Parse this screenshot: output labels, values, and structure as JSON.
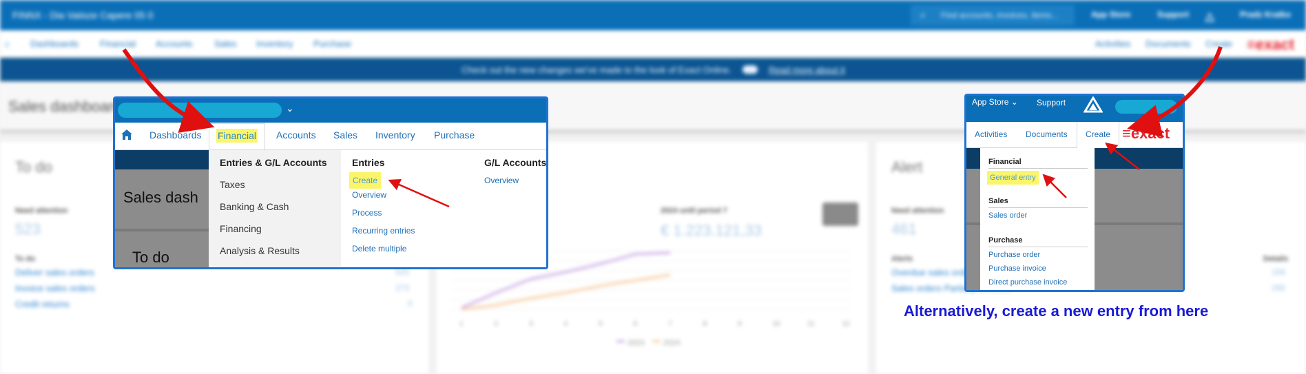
{
  "background": {
    "company": "FINNX - Dia Vaiisze Capere 05 0",
    "search_placeholder": "Find accounts, invoices, items...",
    "top_items": [
      "App Store",
      "Support",
      "Pradz Kratko"
    ],
    "nav_items": [
      "Dashboards",
      "Financial",
      "Accounts",
      "Sales",
      "Inventory",
      "Purchase"
    ],
    "nav_right": [
      "Activities",
      "Documents",
      "Create"
    ],
    "logo": "≡exact",
    "banner_text": "Check out the new changes we've made to the look of Exact Online.",
    "banner_link": "Read more about it",
    "page_title": "Sales dashboard",
    "todo_card": {
      "title": "To do",
      "need_attention": "Need attention",
      "count": "523",
      "section": "To do",
      "links": [
        "Deliver sales orders",
        "Invoice sales orders",
        "Credit returns"
      ],
      "values": [
        "520",
        "273",
        "0"
      ]
    },
    "chart_card": {
      "period_label": "2024 until period 7",
      "amount": "€ 1.223.121,33",
      "x_ticks": [
        "1",
        "2",
        "3",
        "4",
        "5",
        "6",
        "7",
        "8",
        "9",
        "10",
        "11",
        "12"
      ],
      "legend": [
        "2023",
        "2024"
      ]
    },
    "alert_card": {
      "title": "Alert",
      "need_attention": "Need attention",
      "count": "461",
      "col_alerts": "Alerts",
      "col_details": "Details",
      "links": [
        "Overdue sales orders",
        "Sales orders Partially invoiced"
      ],
      "values": [
        "166",
        "295"
      ]
    }
  },
  "popup_left": {
    "nav": [
      "Dashboards",
      "Financial",
      "Accounts",
      "Sales",
      "Inventory",
      "Purchase"
    ],
    "bg_text_1": "Sales dash",
    "bg_text_2": "To do",
    "menu_heading": "Entries & G/L Accounts",
    "menu_side_items": [
      "Taxes",
      "Banking & Cash",
      "Financing",
      "Analysis & Results"
    ],
    "entries_heading": "Entries",
    "entries_links": [
      "Create",
      "Overview",
      "Process",
      "Recurring entries",
      "Delete multiple"
    ],
    "gl_heading": "G/L Accounts",
    "gl_links": [
      "Overview"
    ]
  },
  "popup_right": {
    "top_items": [
      "App Store",
      "Support"
    ],
    "nav": [
      "Activities",
      "Documents",
      "Create"
    ],
    "logo": "≡exact",
    "sections": [
      {
        "title": "Financial",
        "links": [
          "General entry"
        ]
      },
      {
        "title": "Sales",
        "links": [
          "Sales order"
        ]
      },
      {
        "title": "Purchase",
        "links": [
          "Purchase order",
          "Purchase invoice",
          "Direct purchase invoice"
        ]
      }
    ]
  },
  "caption": "Alternatively, create a new entry from here",
  "colors": {
    "brand_blue": "#0b6fb8",
    "highlight": "#faf56a",
    "arrow_red": "#e01010",
    "caption_blue": "#1a1ad6",
    "logo_red": "#e3262f"
  }
}
